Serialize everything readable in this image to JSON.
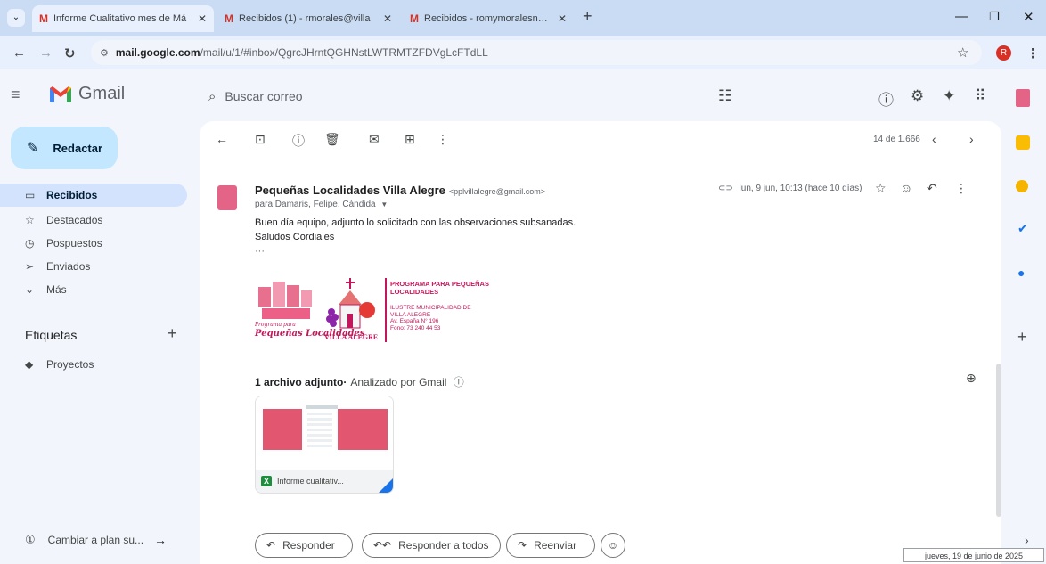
{
  "browser": {
    "tabs": [
      {
        "title": "Informe Cualitativo mes de Má",
        "active": true
      },
      {
        "title": "Recibidos (1) - rmorales@villa",
        "active": false
      },
      {
        "title": "Recibidos - romymoralesn23@",
        "active": false
      }
    ],
    "new_tab": "+",
    "address_host": "mail.google.com",
    "address_path": "/mail/u/1/#inbox/QgrcJHrntQGHNstLWTRMTZFDVgLcFTdLL",
    "profile_initial": "R"
  },
  "gmail": {
    "brand": "Gmail",
    "search_placeholder": "Buscar correo",
    "compose_label": "Redactar",
    "nav": [
      {
        "label": "Recibidos",
        "selected": true,
        "icon": "inbox-icon"
      },
      {
        "label": "Destacados",
        "selected": false,
        "icon": "star-icon"
      },
      {
        "label": "Pospuestos",
        "selected": false,
        "icon": "clock-icon"
      },
      {
        "label": "Enviados",
        "selected": false,
        "icon": "send-icon"
      },
      {
        "label": "Más",
        "selected": false,
        "icon": "chevron-down-icon"
      }
    ],
    "labels_title": "Etiquetas",
    "labels": [
      {
        "label": "Proyectos"
      }
    ],
    "upgrade_label": "Cambiar a plan su..."
  },
  "toolbar": {
    "pager": "14 de 1.666"
  },
  "message": {
    "sender_name": "Pequeñas Localidades Villa Alegre",
    "sender_email": "<pplvillalegre@gmail.com>",
    "recipients": "para Damaris, Felipe, Cándida",
    "date": "lun, 9 jun, 10:13 (hace 10 días)",
    "body_line1": "Buen día equipo, adjunto lo solicitado con las observaciones subsanadas.",
    "body_line2": "Saludos Cordiales",
    "ellipsis": "···",
    "signature": {
      "script_small": "Programa para",
      "script_big": "Pequeñas Localidades",
      "villa": "VILLA ALEGRE",
      "line1": "PROGRAMA PARA PEQUEÑAS",
      "line2": "LOCALIDADES",
      "line3": "ILUSTRE MUNICIPALIDAD DE",
      "line4": "VILLA ALEGRE",
      "line5": "Av. España N° 196",
      "line6": "Fono: 73 240 44 53"
    },
    "attachments_count": "1 archivo adjunto",
    "attachments_scan": "Analizado por Gmail",
    "attachment_name": "Informe cualitativ..."
  },
  "actions": {
    "reply": "Responder",
    "reply_all": "Responder a todos",
    "forward": "Reenviar"
  },
  "taskbar": {
    "date": "jueves, 19 de junio de 2025"
  }
}
